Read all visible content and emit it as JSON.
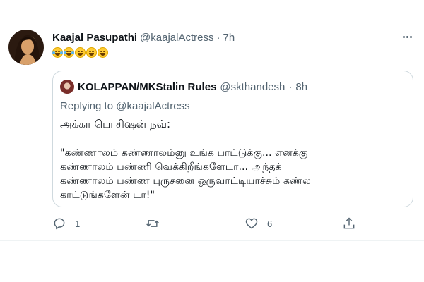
{
  "tweet": {
    "name": "Kaajal Pasupathi",
    "handle": "@kaajalActress",
    "separator": "·",
    "time": "7h",
    "emoji_icons": [
      "laughing-tears-icon",
      "laughing-tears-icon",
      "grinning-sweat-icon",
      "grinning-sweat-icon",
      "grinning-sweat-icon"
    ]
  },
  "quoted": {
    "name": "KOLAPPAN/MKStalin Rules",
    "handle": "@skthandesh",
    "separator": "·",
    "time": "8h",
    "replying": "Replying to @kaajalActress",
    "line1": "அக்கா பொசிஷன் நவ்:",
    "body": [
      "\"கண்ணாலம் கண்ணாலம்னு உங்க பாட்டுக்கு... எனக்கு",
      "கண்ணாலம் பண்ணி வெக்கிறீங்களேடா... அந்தக்",
      "கண்ணாலம் பண்ண புருசனை ஒருவாட்டியாச்சும் கண்ல",
      "காட்டுங்களேன் டா!\""
    ]
  },
  "actions": {
    "reply_count": "1",
    "retweet_count": "",
    "like_count": "6"
  },
  "colors": {
    "text": "#0f1419",
    "secondary": "#536471",
    "border": "#cfd9de"
  }
}
